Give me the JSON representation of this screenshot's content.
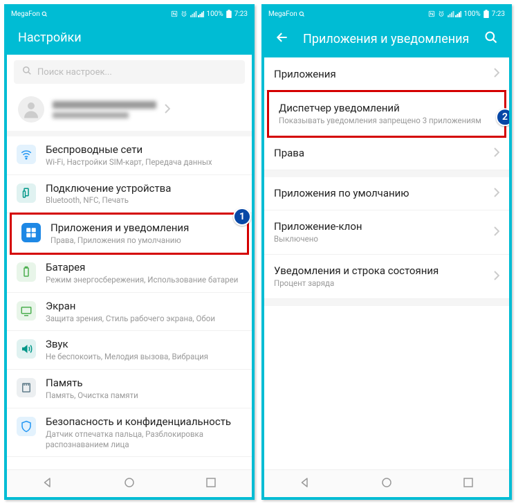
{
  "statusbar": {
    "carrier": "MegaFon",
    "battery": "100%",
    "time": "7:23"
  },
  "left": {
    "header": {
      "title": "Настройки"
    },
    "search": {
      "placeholder": "Поиск настроек..."
    },
    "items": {
      "wireless": {
        "title": "Беспроводные сети",
        "sub": "Wi-Fi, Настройки SIM-карт, Передача данных"
      },
      "devices": {
        "title": "Подключение устройства",
        "sub": "Bluetooth, NFC, Печать"
      },
      "apps": {
        "title": "Приложения и уведомления",
        "sub": "Права, Приложения по умолчанию"
      },
      "battery": {
        "title": "Батарея",
        "sub": "Режим энергосбережения, Использование батареи"
      },
      "display": {
        "title": "Экран",
        "sub": "Защита зрения, Стиль рабочего экрана, Обои"
      },
      "sound": {
        "title": "Звук",
        "sub": "Не беспокоить, Мелодия вызова, Вибрация"
      },
      "memory": {
        "title": "Память",
        "sub": "Память, Очистка памяти"
      },
      "security": {
        "title": "Безопасность и конфиденциальность",
        "sub": "Датчик отпечатка пальца, Разблокировка распознаванием лица"
      }
    },
    "badge": "1"
  },
  "right": {
    "header": {
      "title": "Приложения и уведомления"
    },
    "items": {
      "apps": {
        "title": "Приложения"
      },
      "notif": {
        "title": "Диспетчер уведомлений",
        "sub": "Показывать уведомления запрещено 3 приложениям"
      },
      "perms": {
        "title": "Права"
      },
      "default": {
        "title": "Приложения по умолчанию"
      },
      "clone": {
        "title": "Приложение-клон",
        "sub": "Выключено"
      },
      "status": {
        "title": "Уведомления и строка состояния",
        "sub": "Процент заряда"
      }
    },
    "badge": "2"
  }
}
